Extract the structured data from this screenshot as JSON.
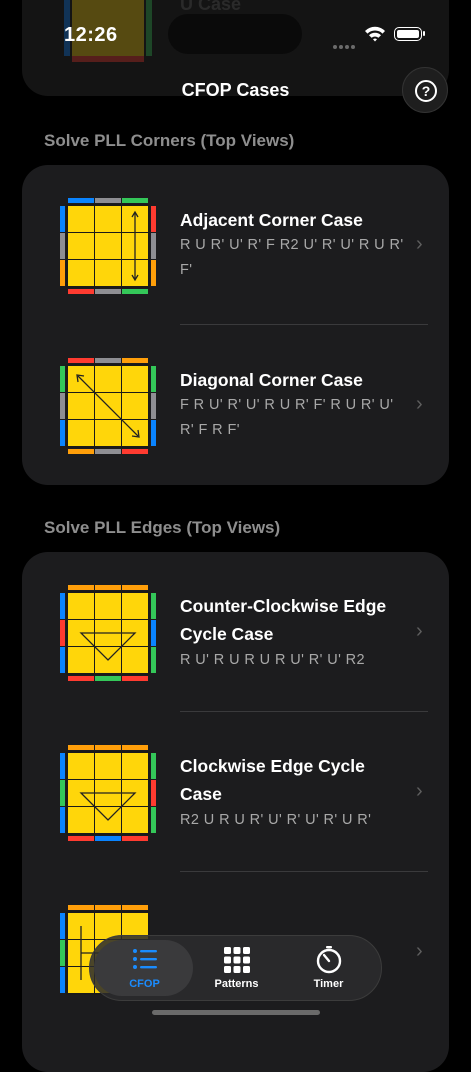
{
  "status": {
    "time": "12:26"
  },
  "ghost": {
    "title": "U Case"
  },
  "nav": {
    "title": "CFOP Cases",
    "help_icon": "question-mark-circle-icon",
    "help_glyph": "?"
  },
  "sections": [
    {
      "title": "Solve PLL Corners (Top Views)",
      "items": [
        {
          "title": "Adjacent Corner Case",
          "moves": "R U R' U' R' F R2 U' R' U' R U R' F'"
        },
        {
          "title": "Diagonal Corner Case",
          "moves": "F R U' R' U' R U R' F' R U R' U' R' F R F'"
        }
      ]
    },
    {
      "title": "Solve PLL Edges (Top Views)",
      "items": [
        {
          "title": "Counter-Clockwise Edge Cycle Case",
          "moves": "R U' R U R U R U' R' U' R2"
        },
        {
          "title": "Clockwise Edge Cycle Case",
          "moves": "R2 U R U R' U' R' U' R' U R'"
        },
        {
          "title": "",
          "moves": ""
        }
      ]
    }
  ],
  "tabs": [
    {
      "label": "CFOP",
      "icon": "list-icon",
      "active": true
    },
    {
      "label": "Patterns",
      "icon": "grid-icon",
      "active": false
    },
    {
      "label": "Timer",
      "icon": "timer-icon",
      "active": false
    }
  ],
  "colors": {
    "accent": "#1a8cff",
    "yellow": "#ffd60a",
    "red": "#ff3b30",
    "green": "#34c759",
    "blue": "#0a84ff",
    "orange": "#ff9f0a",
    "gray": "#8e8e93"
  }
}
